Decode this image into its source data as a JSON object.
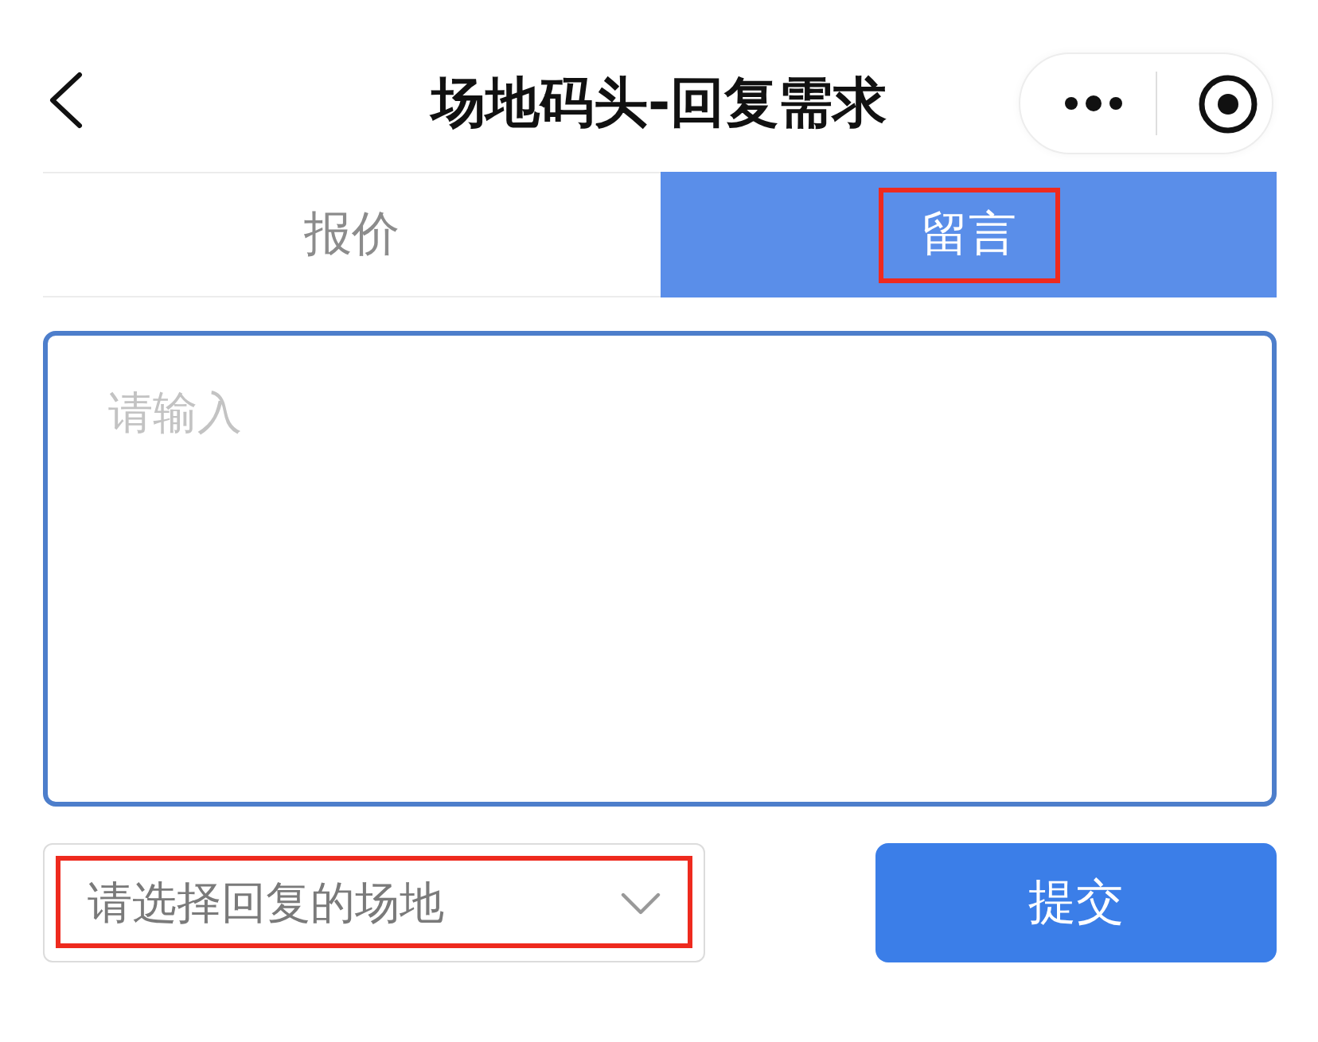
{
  "nav_bar": {
    "title": "场地码头-回复需求"
  },
  "tabs": [
    {
      "label": "报价",
      "selected": false,
      "highlighted": false
    },
    {
      "label": "留言",
      "selected": true,
      "highlighted": true
    }
  ],
  "message_field": {
    "placeholder": "请输入"
  },
  "venue_select": {
    "placeholder": "请选择回复的场地",
    "highlighted": true
  },
  "submit_button": {
    "label": "提交"
  }
}
